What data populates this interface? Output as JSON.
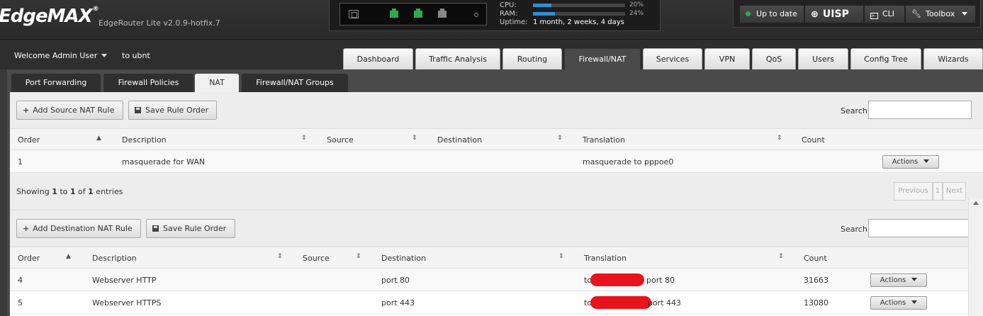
{
  "brand": {
    "logo": "EdgeMAX",
    "logo_mark": "®",
    "model": "EdgeRouter Lite v2.0.9-hotfix.7"
  },
  "status": {
    "cpu_label": "CPU:",
    "cpu_pct": "20%",
    "cpu_value": 0.2,
    "ram_label": "RAM:",
    "ram_pct": "24%",
    "ram_value": 0.24,
    "uptime_label": "Uptime:",
    "uptime_value": "1 month, 2 weeks, 4 days"
  },
  "tools": {
    "update": "Up to date",
    "uisp": "UISP",
    "cli": "CLI",
    "toolbox": "Toolbox"
  },
  "user": {
    "welcome": "Welcome Admin User",
    "host": "to ubnt"
  },
  "main_tabs": [
    "Dashboard",
    "Traffic Analysis",
    "Routing",
    "Firewall/NAT",
    "Services",
    "VPN",
    "QoS",
    "Users",
    "Config Tree",
    "Wizards"
  ],
  "sub_tabs": [
    "Port Forwarding",
    "Firewall Policies",
    "NAT",
    "Firewall/NAT Groups"
  ],
  "search_label": "Search",
  "source_nat": {
    "add_button": "Add Source NAT Rule",
    "save_button": "Save Rule Order",
    "columns": [
      "Order",
      "Description",
      "Source",
      "Destination",
      "Translation",
      "Count"
    ],
    "rows": [
      {
        "order": "1",
        "description": "masquerade for WAN",
        "source": "",
        "destination": "",
        "translation": "masquerade to pppoe0",
        "count": "",
        "actions": "Actions"
      }
    ],
    "showing_prefix": "Showing ",
    "showing_from": "1",
    "showing_to_word": " to ",
    "showing_to": "1",
    "showing_of_word": " of ",
    "showing_total": "1",
    "showing_suffix": " entries",
    "pager": {
      "previous": "Previous",
      "page": "1",
      "next": "Next"
    }
  },
  "dest_nat": {
    "add_button": "Add Destination NAT Rule",
    "save_button": "Save Rule Order",
    "columns": [
      "Order",
      "Description",
      "Source",
      "Destination",
      "Translation",
      "Count"
    ],
    "rows": [
      {
        "order": "4",
        "description": "Webserver HTTP",
        "source": "",
        "destination": "port 80",
        "translation_prefix": "to",
        "translation_suffix": "port 80",
        "count": "31663",
        "actions": "Actions"
      },
      {
        "order": "5",
        "description": "Webserver HTTPS",
        "source": "",
        "destination": "port 443",
        "translation_prefix": "to",
        "translation_suffix": "port 443",
        "count": "13080",
        "actions": "Actions"
      }
    ]
  },
  "colors": {
    "accent_green": "#2eaa4e",
    "bar_blue": "#2f8fd5",
    "redaction": "#e8141b"
  }
}
